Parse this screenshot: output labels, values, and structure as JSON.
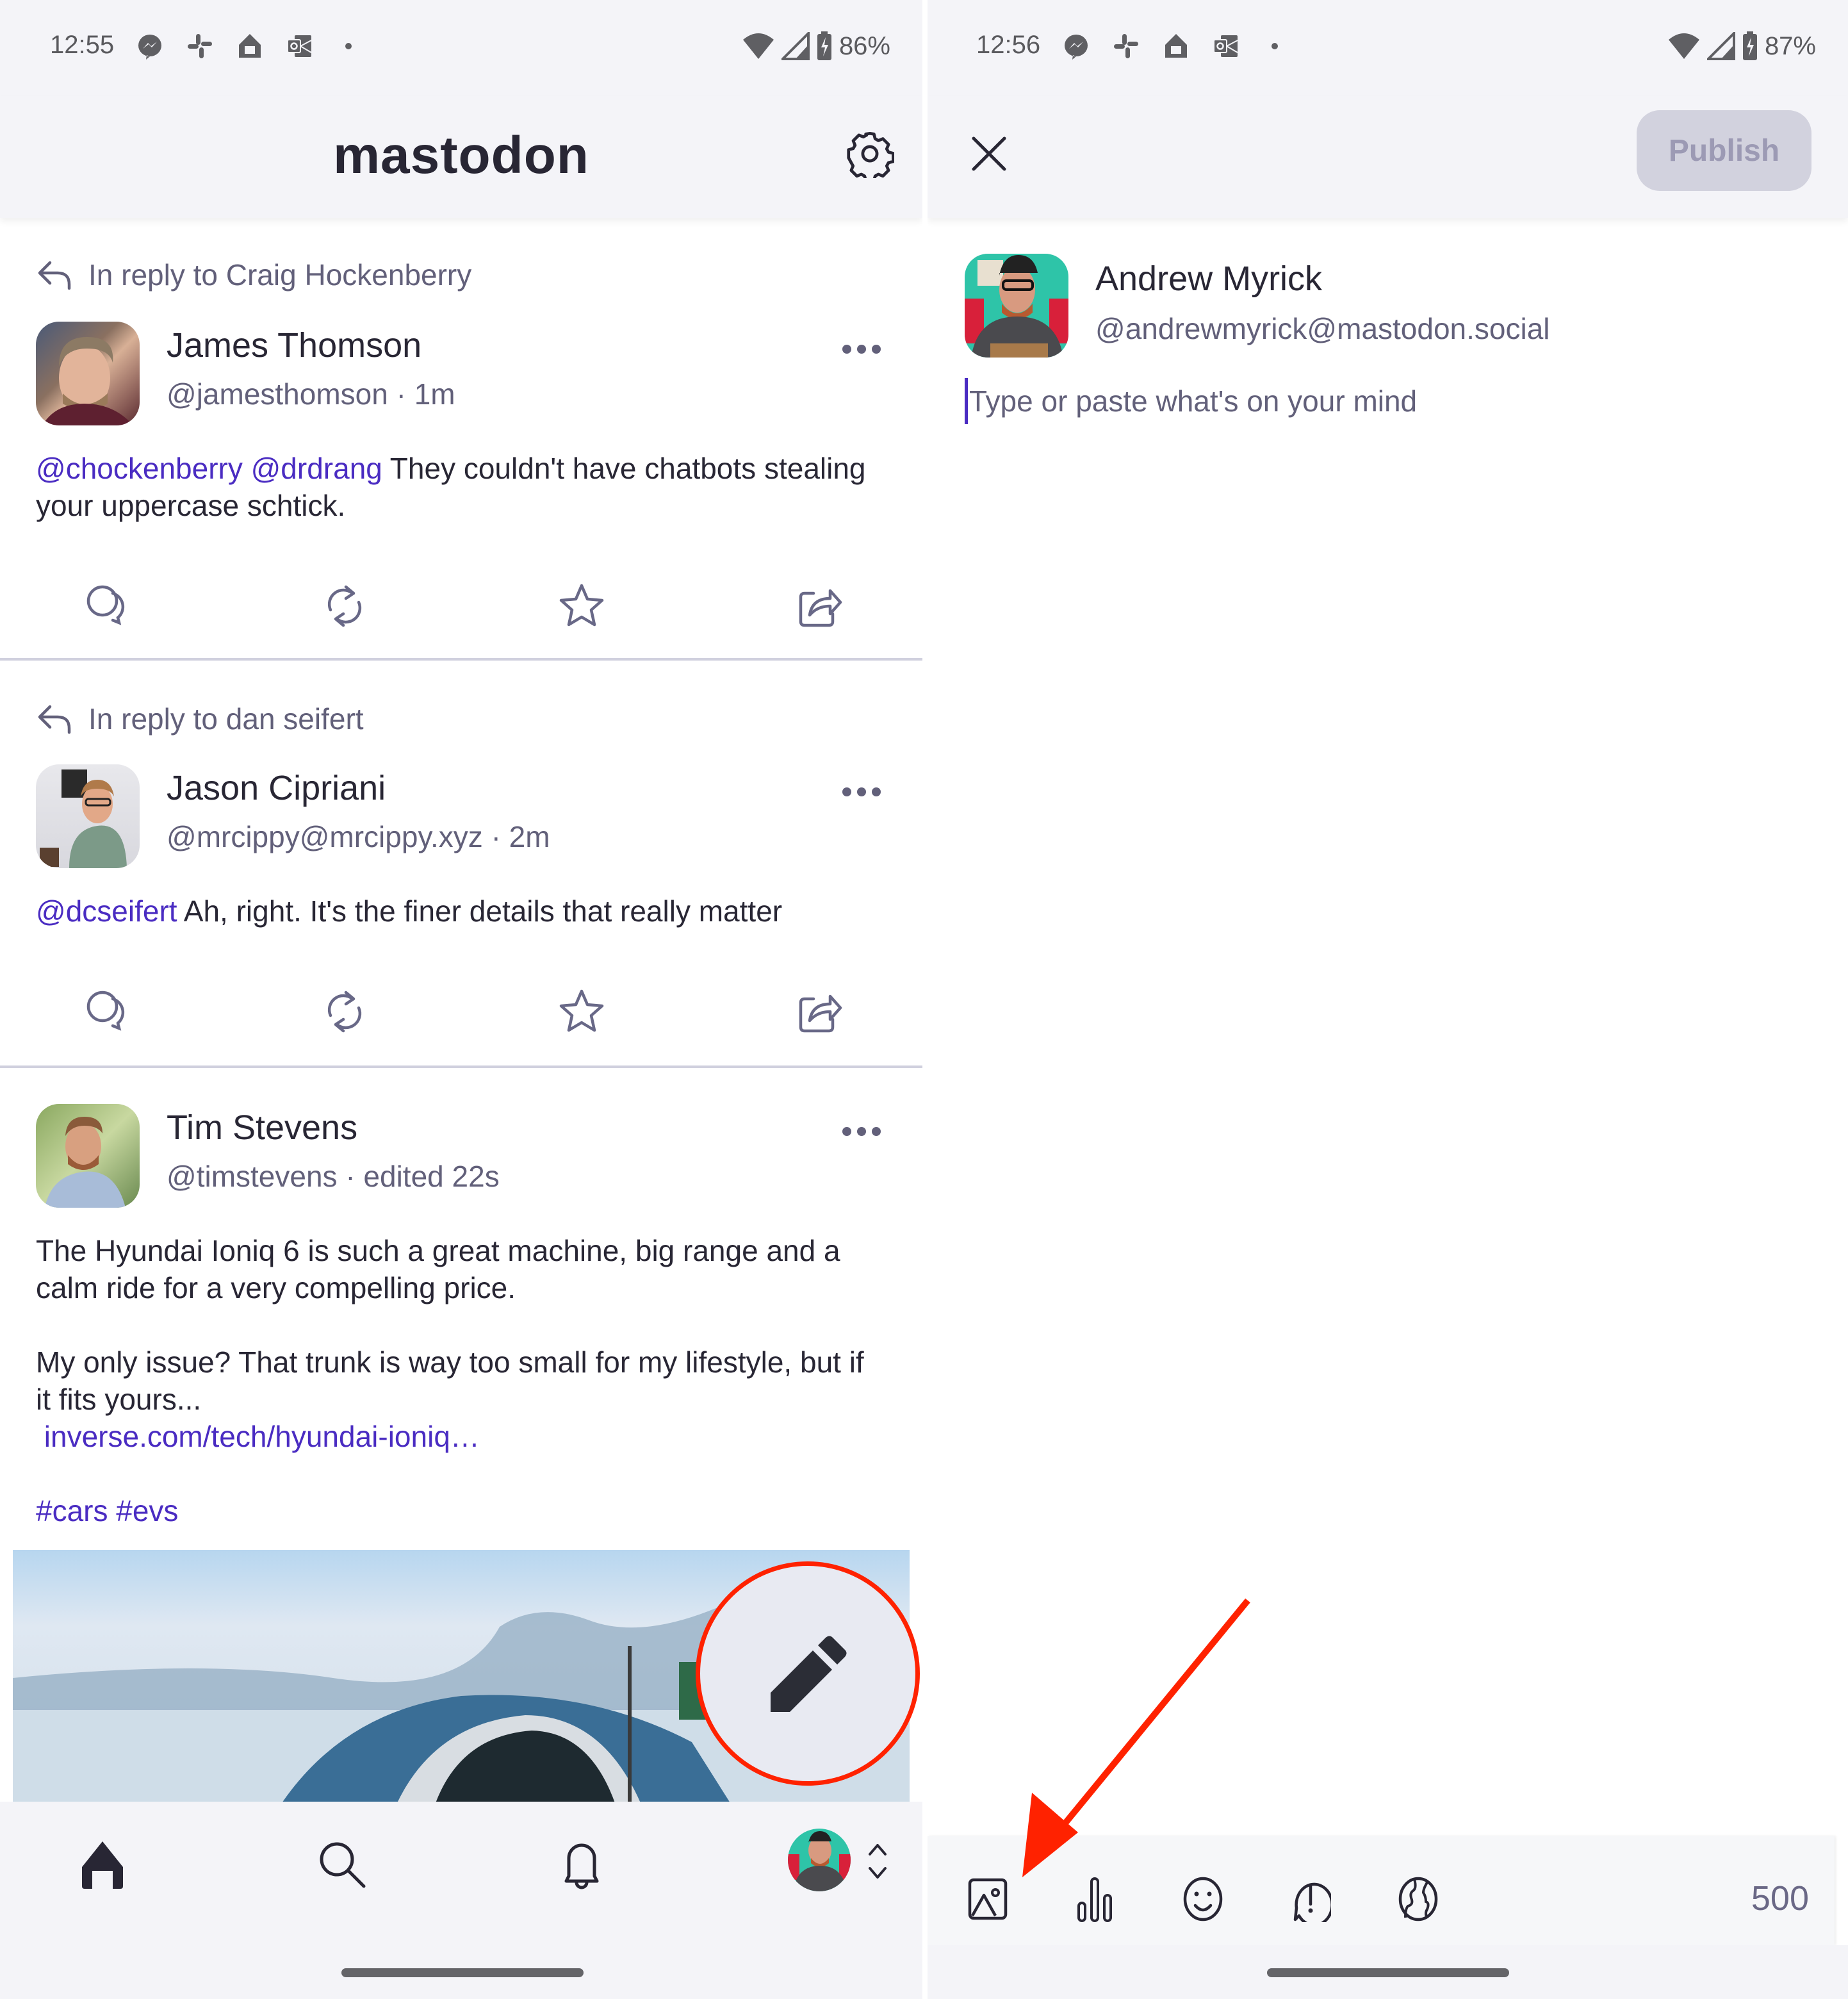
{
  "left_screen": {
    "status_bar": {
      "time": "12:55",
      "notification_icons": [
        "messenger-icon",
        "slack-icon",
        "google-home-icon",
        "outlook-icon",
        "more-dot-icon"
      ],
      "battery": "86%",
      "system_icons": [
        "wifi-icon",
        "cell-signal-icon",
        "battery-charging-icon"
      ]
    },
    "app_bar": {
      "title": "mastodon",
      "settings_icon": "gear-icon"
    },
    "posts": [
      {
        "reply_to": "In reply to Craig Hockenberry",
        "name": "James Thomson",
        "handle": "@jamesthomson · 1m",
        "mentions": "@chockenberry @drdrang",
        "text": " They couldn't have chatbots stealing your uppercase schtick."
      },
      {
        "reply_to": "In reply to dan seifert",
        "name": "Jason Cipriani",
        "handle": "@mrcippy@mrcippy.xyz · 2m",
        "mentions": "@dcseifert",
        "text": " Ah, right. It's the finer details that really matter"
      },
      {
        "name": "Tim Stevens",
        "handle": "@timstevens · edited 22s",
        "text": "The Hyundai Ioniq 6 is such a great machine, big range and a calm ride for a very compelling price.\n\nMy only issue? That trunk is way too small for my lifestyle, but if it fits yours...",
        "link": " inverse.com/tech/hyundai-ioniq…",
        "hashtags": "#cars #evs"
      }
    ],
    "post_actions": [
      "reply-icon",
      "boost-icon",
      "favorite-icon",
      "share-icon"
    ],
    "fab": {
      "icon": "pencil-icon",
      "label": "Compose"
    },
    "bottom_nav": [
      "home-icon",
      "search-icon",
      "notifications-bell-icon",
      "profile-avatar"
    ]
  },
  "right_screen": {
    "status_bar": {
      "time": "12:56",
      "notification_icons": [
        "messenger-icon",
        "slack-icon",
        "google-home-icon",
        "outlook-icon",
        "more-dot-icon"
      ],
      "battery": "87%"
    },
    "header": {
      "close_icon": "close-icon",
      "publish_label": "Publish"
    },
    "composer": {
      "name": "Andrew Myrick",
      "handle": "@andrewmyrick@mastodon.social",
      "placeholder": "Type or paste what's on your mind",
      "value": ""
    },
    "toolbar": {
      "tools": [
        "add-media-icon",
        "poll-icon",
        "emoji-icon",
        "content-warning-icon",
        "language-globe-icon"
      ],
      "char_count": "500"
    }
  },
  "annotations": {
    "color": "#ff2200"
  },
  "colors": {
    "accent": "#4a2cc2",
    "text_primary": "#282634",
    "text_secondary": "#62607a",
    "bar_bg": "#f4f4f8",
    "publish_disabled_bg": "#d2d2de"
  }
}
